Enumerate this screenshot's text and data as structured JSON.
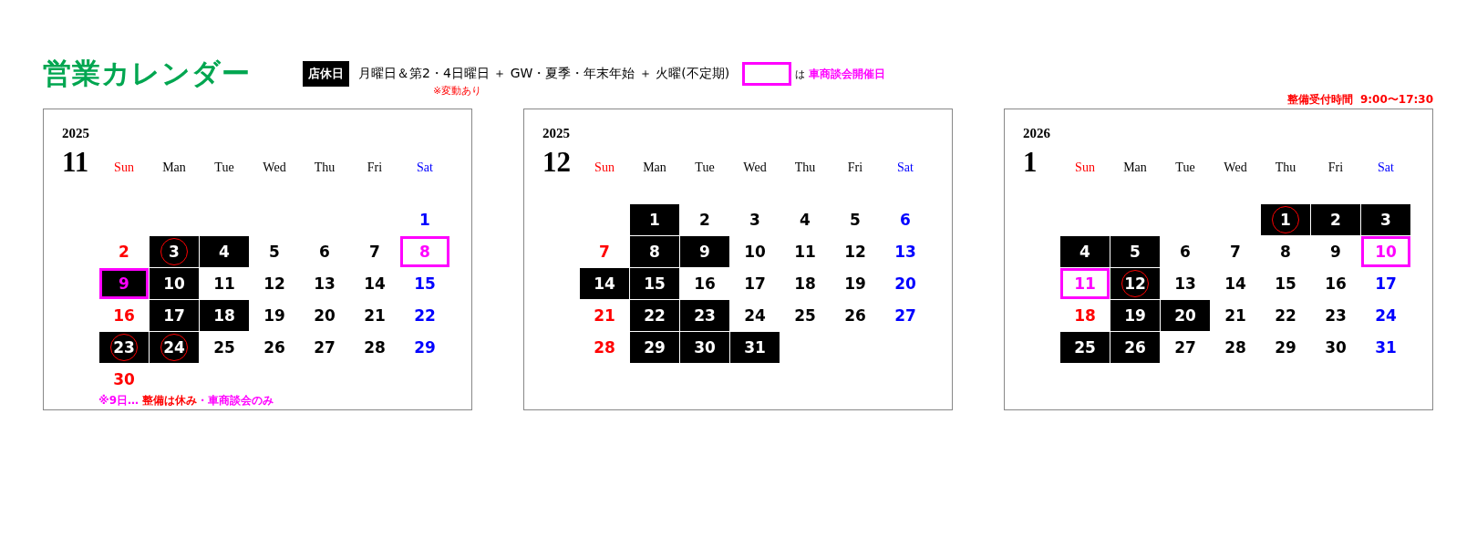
{
  "title": "営業カレンダー",
  "legend": {
    "closed_badge": "店休日",
    "closed_text": "月曜日＆第2・4日曜日 ＋ GW・夏季・年末年始 ＋ 火曜(不定期)",
    "closed_note": "※変動あり",
    "meeting_label_prefix": "は",
    "meeting_label": "車商談会開催日"
  },
  "service_hours": "整備受付時間  9:00〜17:30",
  "months": [
    {
      "year": "2025",
      "month": "11",
      "weekdays": [
        "Sun",
        "Man",
        "Tue",
        "Wed",
        "Thu",
        "Fri",
        "Sat"
      ],
      "note": "※9日… **整備は休み**・車商談会のみ",
      "weeks": [
        [
          {
            "n": "1",
            "closed": false,
            "meeting": false,
            "circled": false
          }
        ],
        [
          {
            "n": "2",
            "closed": false,
            "meeting": false,
            "circled": false
          },
          {
            "n": "3",
            "closed": true,
            "meeting": false,
            "circled": true
          },
          {
            "n": "4",
            "closed": true,
            "meeting": false,
            "circled": false
          },
          {
            "n": "5",
            "closed": false,
            "meeting": false,
            "circled": false
          },
          {
            "n": "6",
            "closed": false,
            "meeting": false,
            "circled": false
          },
          {
            "n": "7",
            "closed": false,
            "meeting": false,
            "circled": false
          },
          {
            "n": "8",
            "closed": false,
            "meeting": true,
            "circled": false
          }
        ],
        [
          {
            "n": "9",
            "closed": true,
            "meeting": true,
            "circled": false
          },
          {
            "n": "10",
            "closed": true,
            "meeting": false,
            "circled": false
          },
          {
            "n": "11",
            "closed": false,
            "meeting": false,
            "circled": false
          },
          {
            "n": "12",
            "closed": false,
            "meeting": false,
            "circled": false
          },
          {
            "n": "13",
            "closed": false,
            "meeting": false,
            "circled": false
          },
          {
            "n": "14",
            "closed": false,
            "meeting": false,
            "circled": false
          },
          {
            "n": "15",
            "closed": false,
            "meeting": false,
            "circled": false
          }
        ],
        [
          {
            "n": "16",
            "closed": false,
            "meeting": false,
            "circled": false
          },
          {
            "n": "17",
            "closed": true,
            "meeting": false,
            "circled": false
          },
          {
            "n": "18",
            "closed": true,
            "meeting": false,
            "circled": false
          },
          {
            "n": "19",
            "closed": false,
            "meeting": false,
            "circled": false
          },
          {
            "n": "20",
            "closed": false,
            "meeting": false,
            "circled": false
          },
          {
            "n": "21",
            "closed": false,
            "meeting": false,
            "circled": false
          },
          {
            "n": "22",
            "closed": false,
            "meeting": false,
            "circled": false
          }
        ],
        [
          {
            "n": "23",
            "closed": true,
            "meeting": false,
            "circled": true
          },
          {
            "n": "24",
            "closed": true,
            "meeting": false,
            "circled": true
          },
          {
            "n": "25",
            "closed": false,
            "meeting": false,
            "circled": false
          },
          {
            "n": "26",
            "closed": false,
            "meeting": false,
            "circled": false
          },
          {
            "n": "27",
            "closed": false,
            "meeting": false,
            "circled": false
          },
          {
            "n": "28",
            "closed": false,
            "meeting": false,
            "circled": false
          },
          {
            "n": "29",
            "closed": false,
            "meeting": false,
            "circled": false
          }
        ],
        [
          {
            "n": "30",
            "closed": false,
            "meeting": false,
            "circled": false
          }
        ]
      ]
    },
    {
      "year": "2025",
      "month": "12",
      "weekdays": [
        "Sun",
        "Man",
        "Tue",
        "Wed",
        "Thu",
        "Fri",
        "Sat"
      ],
      "weeks": [
        [
          {
            "n": "1",
            "closed": true,
            "meeting": false,
            "circled": false
          },
          {
            "n": "2",
            "closed": false,
            "meeting": false,
            "circled": false
          },
          {
            "n": "3",
            "closed": false,
            "meeting": false,
            "circled": false
          },
          {
            "n": "4",
            "closed": false,
            "meeting": false,
            "circled": false
          },
          {
            "n": "5",
            "closed": false,
            "meeting": false,
            "circled": false
          },
          {
            "n": "6",
            "closed": false,
            "meeting": false,
            "circled": false
          }
        ],
        [
          {
            "n": "7",
            "closed": false,
            "meeting": false,
            "circled": false
          },
          {
            "n": "8",
            "closed": true,
            "meeting": false,
            "circled": false
          },
          {
            "n": "9",
            "closed": true,
            "meeting": false,
            "circled": false
          },
          {
            "n": "10",
            "closed": false,
            "meeting": false,
            "circled": false
          },
          {
            "n": "11",
            "closed": false,
            "meeting": false,
            "circled": false
          },
          {
            "n": "12",
            "closed": false,
            "meeting": false,
            "circled": false
          },
          {
            "n": "13",
            "closed": false,
            "meeting": false,
            "circled": false
          }
        ],
        [
          {
            "n": "14",
            "closed": true,
            "meeting": false,
            "circled": false
          },
          {
            "n": "15",
            "closed": true,
            "meeting": false,
            "circled": false
          },
          {
            "n": "16",
            "closed": false,
            "meeting": false,
            "circled": false
          },
          {
            "n": "17",
            "closed": false,
            "meeting": false,
            "circled": false
          },
          {
            "n": "18",
            "closed": false,
            "meeting": false,
            "circled": false
          },
          {
            "n": "19",
            "closed": false,
            "meeting": false,
            "circled": false
          },
          {
            "n": "20",
            "closed": false,
            "meeting": false,
            "circled": false
          }
        ],
        [
          {
            "n": "21",
            "closed": false,
            "meeting": false,
            "circled": false
          },
          {
            "n": "22",
            "closed": true,
            "meeting": false,
            "circled": false
          },
          {
            "n": "23",
            "closed": true,
            "meeting": false,
            "circled": false
          },
          {
            "n": "24",
            "closed": false,
            "meeting": false,
            "circled": false
          },
          {
            "n": "25",
            "closed": false,
            "meeting": false,
            "circled": false
          },
          {
            "n": "26",
            "closed": false,
            "meeting": false,
            "circled": false
          },
          {
            "n": "27",
            "closed": false,
            "meeting": false,
            "circled": false
          }
        ],
        [
          {
            "n": "28",
            "closed": false,
            "meeting": false,
            "circled": false
          },
          {
            "n": "29",
            "closed": true,
            "meeting": false,
            "circled": false
          },
          {
            "n": "30",
            "closed": true,
            "meeting": false,
            "circled": false
          },
          {
            "n": "31",
            "closed": true,
            "meeting": false,
            "circled": false
          }
        ]
      ]
    },
    {
      "year": "2026",
      "month": "1",
      "weekdays": [
        "Sun",
        "Man",
        "Tue",
        "Wed",
        "Thu",
        "Fri",
        "Sat"
      ],
      "weeks": [
        [
          {
            "n": "1",
            "closed": true,
            "meeting": false,
            "circled": true
          },
          {
            "n": "2",
            "closed": true,
            "meeting": false,
            "circled": false
          },
          {
            "n": "3",
            "closed": true,
            "meeting": false,
            "circled": false
          }
        ],
        [
          {
            "n": "4",
            "closed": true,
            "meeting": false,
            "circled": false
          },
          {
            "n": "5",
            "closed": true,
            "meeting": false,
            "circled": false
          },
          {
            "n": "6",
            "closed": false,
            "meeting": false,
            "circled": false
          },
          {
            "n": "7",
            "closed": false,
            "meeting": false,
            "circled": false
          },
          {
            "n": "8",
            "closed": false,
            "meeting": false,
            "circled": false
          },
          {
            "n": "9",
            "closed": false,
            "meeting": false,
            "circled": false
          },
          {
            "n": "10",
            "closed": false,
            "meeting": true,
            "circled": false
          }
        ],
        [
          {
            "n": "11",
            "closed": false,
            "meeting": true,
            "circled": false
          },
          {
            "n": "12",
            "closed": true,
            "meeting": false,
            "circled": true
          },
          {
            "n": "13",
            "closed": false,
            "meeting": false,
            "circled": false
          },
          {
            "n": "14",
            "closed": false,
            "meeting": false,
            "circled": false
          },
          {
            "n": "15",
            "closed": false,
            "meeting": false,
            "circled": false
          },
          {
            "n": "16",
            "closed": false,
            "meeting": false,
            "circled": false
          },
          {
            "n": "17",
            "closed": false,
            "meeting": false,
            "circled": false
          }
        ],
        [
          {
            "n": "18",
            "closed": false,
            "meeting": false,
            "circled": false
          },
          {
            "n": "19",
            "closed": true,
            "meeting": false,
            "circled": false
          },
          {
            "n": "20",
            "closed": true,
            "meeting": false,
            "circled": false
          },
          {
            "n": "21",
            "closed": false,
            "meeting": false,
            "circled": false
          },
          {
            "n": "22",
            "closed": false,
            "meeting": false,
            "circled": false
          },
          {
            "n": "23",
            "closed": false,
            "meeting": false,
            "circled": false
          },
          {
            "n": "24",
            "closed": false,
            "meeting": false,
            "circled": false
          }
        ],
        [
          {
            "n": "25",
            "closed": true,
            "meeting": false,
            "circled": false
          },
          {
            "n": "26",
            "closed": true,
            "meeting": false,
            "circled": false
          },
          {
            "n": "27",
            "closed": false,
            "meeting": false,
            "circled": false
          },
          {
            "n": "28",
            "closed": false,
            "meeting": false,
            "circled": false
          },
          {
            "n": "29",
            "closed": false,
            "meeting": false,
            "circled": false
          },
          {
            "n": "30",
            "closed": false,
            "meeting": false,
            "circled": false
          },
          {
            "n": "31",
            "closed": false,
            "meeting": false,
            "circled": false
          }
        ]
      ]
    }
  ]
}
